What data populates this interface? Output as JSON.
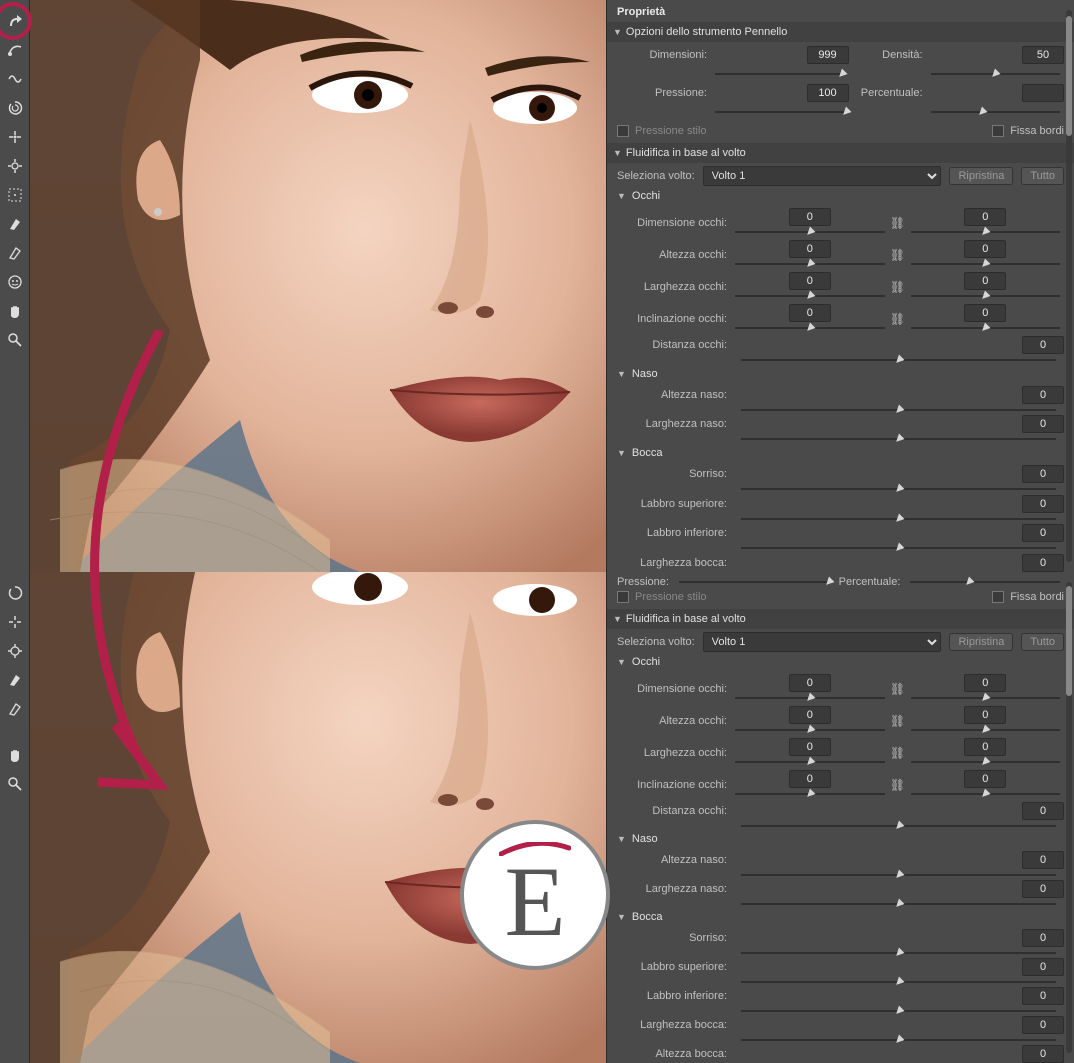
{
  "tools": [
    "warp",
    "reconstruct",
    "smooth",
    "twirl",
    "pucker",
    "bloat",
    "push",
    "freeze",
    "thaw",
    "face",
    "hand",
    "zoom"
  ],
  "panel_title": "Proprietà",
  "brush": {
    "title": "Opzioni dello strumento Pennello",
    "size_lbl": "Dimensioni:",
    "density_lbl": "Densità:",
    "pressure_lbl": "Pressione:",
    "rate_lbl": "Percentuale:",
    "size": "999",
    "density": "50",
    "pressure": "100",
    "rate": "",
    "stylus_lbl": "Pressione stilo",
    "pin_lbl": "Fissa bordi"
  },
  "face": {
    "title": "Fluidifica in base al volto",
    "select_lbl": "Seleziona volto:",
    "select_val": "Volto 1",
    "reset_lbl": "Ripristina",
    "all_lbl": "Tutto",
    "eyes": {
      "title": "Occhi",
      "size_lbl": "Dimensione occhi:",
      "height_lbl": "Altezza occhi:",
      "width_lbl": "Larghezza occhi:",
      "tilt_lbl": "Inclinazione occhi:",
      "dist_lbl": "Distanza occhi:",
      "zero": "0"
    },
    "nose": {
      "title": "Naso",
      "height_lbl": "Altezza naso:",
      "width_lbl": "Larghezza naso:",
      "zero": "0"
    },
    "mouth": {
      "title": "Bocca",
      "smile_lbl": "Sorriso:",
      "upper_lbl": "Labbro superiore:",
      "lower_lbl": "Labbro inferiore:",
      "width_lbl": "Larghezza bocca:",
      "height_lbl": "Altezza bocca:",
      "zero": "0"
    }
  },
  "bottom": {
    "pressure_lbl": "Pressione:",
    "rate_lbl": "Percentuale:",
    "stylus_lbl": "Pressione stilo",
    "pin_lbl": "Fissa bordi"
  }
}
